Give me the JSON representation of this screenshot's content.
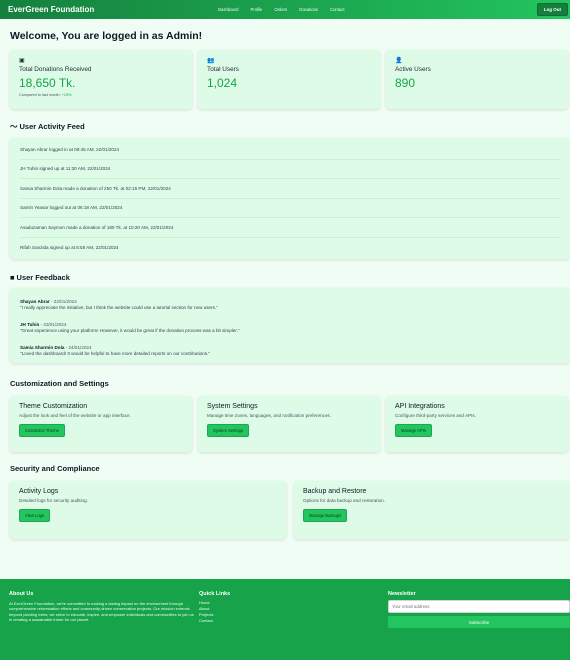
{
  "nav": {
    "brand": "EverGreen Foundation",
    "links": [
      "Dashboard",
      "Profile",
      "Orders",
      "Donations",
      "Contact"
    ],
    "logout": "Log Out"
  },
  "welcome": "Welcome, You are logged in as Admin!",
  "stats": [
    {
      "label": "Total Donations Received",
      "value": "18,650 Tk.",
      "sub": "Compared to last month:",
      "change": "+15%",
      "icon": "donation-box-icon"
    },
    {
      "label": "Total Users",
      "value": "1,024",
      "icon": "users-icon"
    },
    {
      "label": "Active Users",
      "value": "890",
      "icon": "user-check-icon"
    }
  ],
  "activity": {
    "title": "User Activity Feed",
    "items": [
      "Shayan Abrar logged in at 09:45 AM, 22/01/2024",
      "JH Tuhin signed up at 11:30 AM, 22/01/2024",
      "Samia Sharmin Dola made a donation of 250 Tk. at 02:15 PM, 22/01/2024",
      "Samin Yeasar logged out at 06:18 AM, 22/01/2024",
      "Asaduzaman Saymon made a donation of 180 Tk. at 10:20 AM, 22/01/2024",
      "Rifah Sanzida signed up at 8:58 AM, 22/01/2024"
    ]
  },
  "feedback": {
    "title": "User Feedback",
    "items": [
      {
        "name": "Shayan Abrar",
        "date": " - 22/01/2024",
        "text": "\"I really appreciate the initiative, but I think the website could use a tutorial section for new users.\""
      },
      {
        "name": "JH Tuhin",
        "date": " - 23/01/2024",
        "text": "\"Great experience using your platform! However, it would be great if the donation process was a bit simpler.\""
      },
      {
        "name": "Samia Sharmin Dola",
        "date": " - 24/01/2024",
        "text": "\"Loved the dashboard! It would be helpful to have more detailed reports on our contributions.\""
      }
    ]
  },
  "customization": {
    "title": "Customization and Settings",
    "cards": [
      {
        "title": "Theme Customization",
        "desc": "Adjust the look and feel of the website or app interface.",
        "button": "Customize Theme"
      },
      {
        "title": "System Settings",
        "desc": "Manage time zones, languages, and notification preferences.",
        "button": "System Settings"
      },
      {
        "title": "API Integrations",
        "desc": "Configure third-party services and APIs.",
        "button": "Manage APIs"
      }
    ]
  },
  "security": {
    "title": "Security and Compliance",
    "cards": [
      {
        "title": "Activity Logs",
        "desc": "Detailed logs for security auditing.",
        "button": "View Logs"
      },
      {
        "title": "Backup and Restore",
        "desc": "Options for data backup and restoration.",
        "button": "Manage Backups"
      }
    ]
  },
  "footer": {
    "about_title": "About Us",
    "about_text": "At EverGreen Foundation, we're committed to making a lasting impact on the environment through comprehensive reforestation efforts and community-driven conservation projects. Our mission extends beyond planting trees; we strive to educate, inspire, and empower individuals and communities to join us in creating a sustainable future for our planet.",
    "links_title": "Quick Links",
    "links": [
      "Home",
      "About",
      "Projects",
      "Contact"
    ],
    "newsletter_title": "Newsletter",
    "email_placeholder": "Your email address",
    "subscribe": "Subscribe"
  },
  "colors": {
    "accent": "#22c55e",
    "nav": "#16a34a",
    "card_bg": "#ddfbe6",
    "page_bg": "#effdf4"
  }
}
